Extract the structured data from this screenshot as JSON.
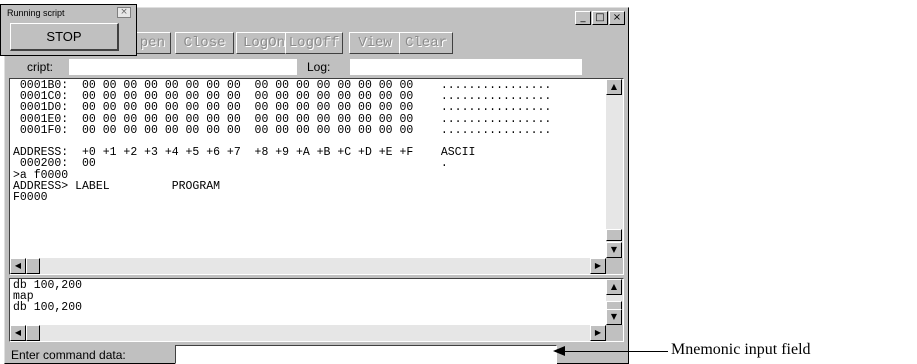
{
  "window": {
    "caption_buttons": [
      "_",
      "□",
      "×"
    ]
  },
  "toolbar": {
    "buttons": [
      "Open",
      "Close",
      "LogOn",
      "LogOff",
      "View",
      "Clear"
    ],
    "open_visible_fragment": "pen"
  },
  "labels": {
    "script_label_fragment": "cript:",
    "log_label": "Log:"
  },
  "dump_pane": {
    "lines": [
      " 0001B0:  00 00 00 00 00 00 00 00  00 00 00 00 00 00 00 00    ................",
      " 0001C0:  00 00 00 00 00 00 00 00  00 00 00 00 00 00 00 00    ................",
      " 0001D0:  00 00 00 00 00 00 00 00  00 00 00 00 00 00 00 00    ................",
      " 0001E0:  00 00 00 00 00 00 00 00  00 00 00 00 00 00 00 00    ................",
      " 0001F0:  00 00 00 00 00 00 00 00  00 00 00 00 00 00 00 00    ................",
      "",
      "ADDRESS:  +0 +1 +2 +3 +4 +5 +6 +7  +8 +9 +A +B +C +D +E +F    ASCII",
      " 000200:  00                                                  .",
      ">a f0000",
      "ADDRESS> LABEL         PROGRAM",
      "F0000"
    ]
  },
  "history_pane": {
    "lines": [
      "db 100,200",
      "map",
      "db 100,200"
    ]
  },
  "command": {
    "label": "Enter command data:",
    "value": ""
  },
  "popup": {
    "title": "Running script",
    "close_glyph": "×",
    "stop_label": "STOP"
  },
  "annotation": {
    "text": "Mnemonic input field"
  },
  "icons": {
    "scroll_up": "▲",
    "scroll_down": "▼",
    "scroll_left": "◀",
    "scroll_right": "▶"
  }
}
